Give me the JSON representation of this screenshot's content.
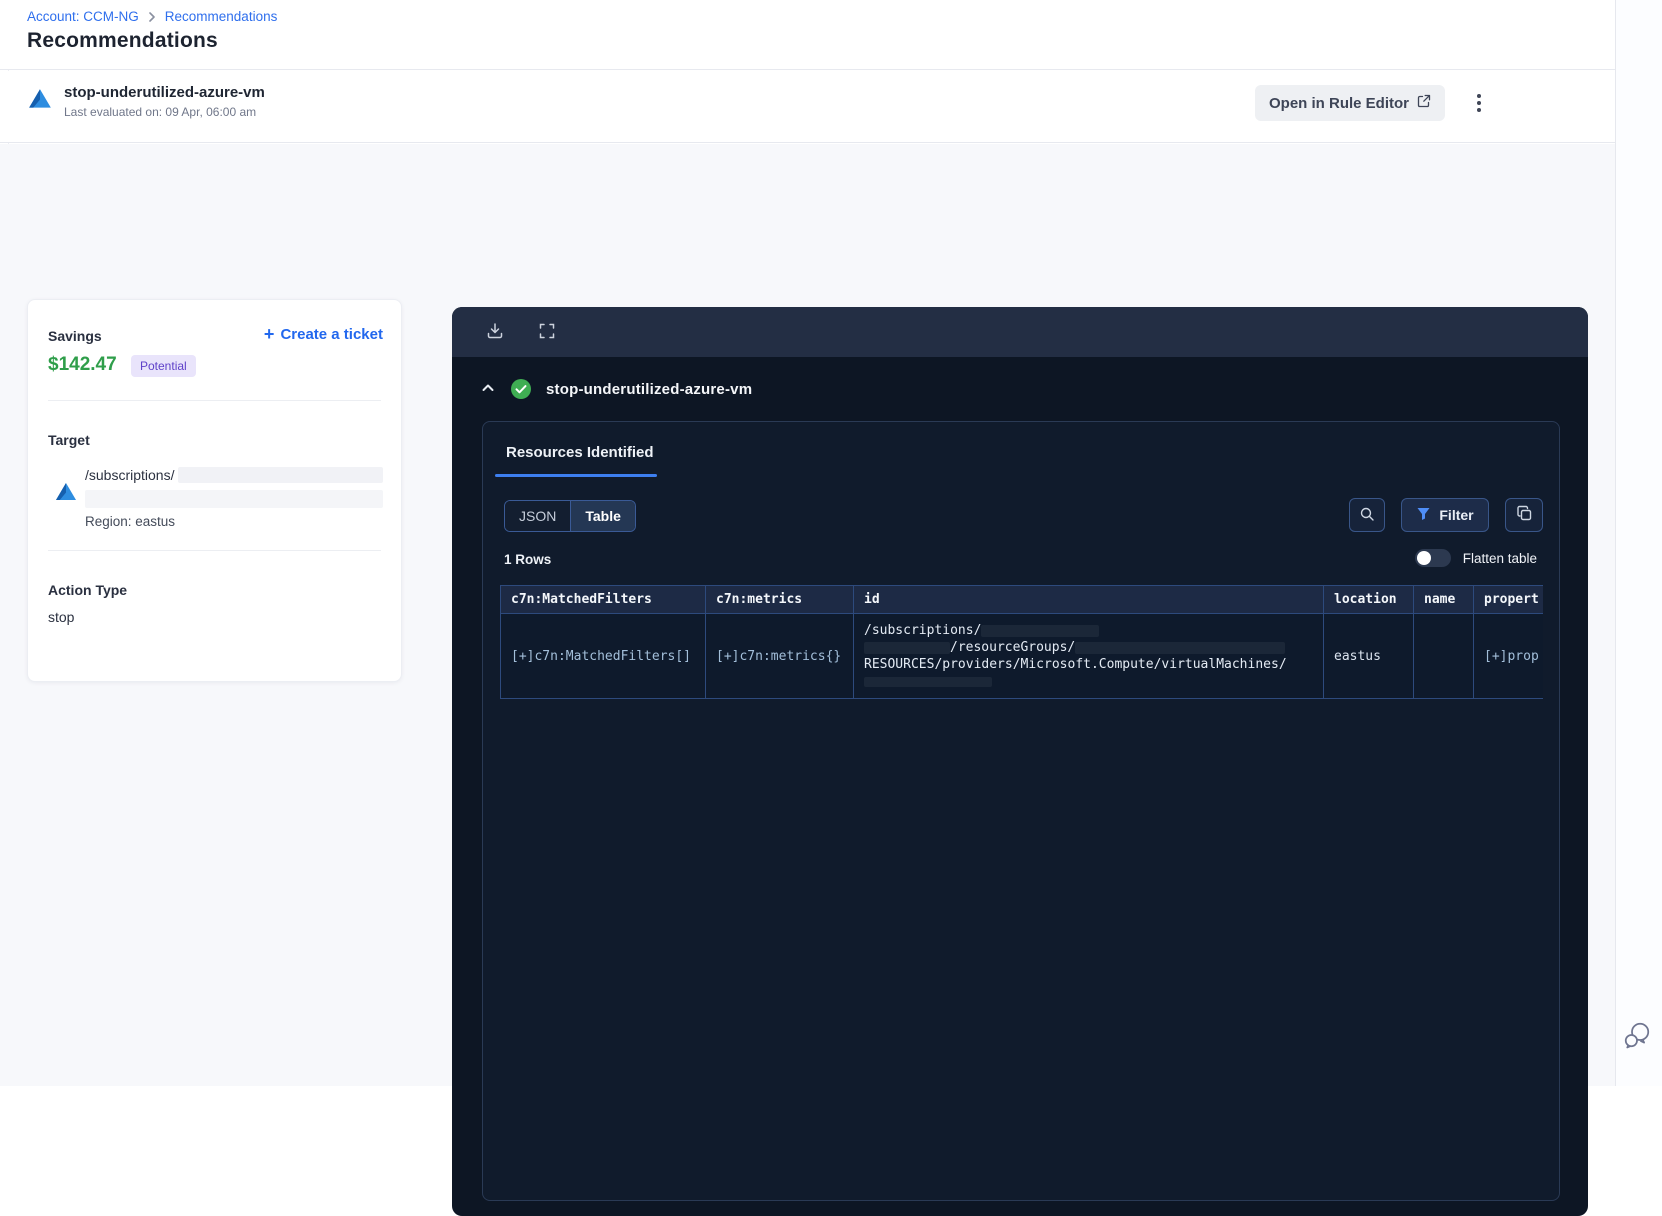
{
  "breadcrumb": {
    "account_link": "Account: CCM-NG",
    "current": "Recommendations"
  },
  "page": {
    "title": "Recommendations"
  },
  "rule_header": {
    "name": "stop-underutilized-azure-vm",
    "last_evaluated": "Last evaluated on: 09 Apr, 06:00 am",
    "open_in_rule_editor": "Open in Rule Editor"
  },
  "savings_card": {
    "savings_label": "Savings",
    "amount": "$142.47",
    "badge": "Potential",
    "create_ticket": {
      "plus": "+",
      "label": "Create a ticket"
    },
    "target": {
      "label": "Target",
      "path": "/subscriptions/",
      "region": "Region: eastus"
    },
    "action_type": {
      "label": "Action Type",
      "value": "stop"
    }
  },
  "viewer": {
    "rule_name": "stop-underutilized-azure-vm",
    "tab_label": "Resources Identified",
    "view_toggle": {
      "json": "JSON",
      "table": "Table",
      "selected": "Table"
    },
    "filter_button": "Filter",
    "rows_count": "1 Rows",
    "flatten_toggle": {
      "label": "Flatten table",
      "state": "off"
    },
    "table": {
      "columns": [
        "c7n:MatchedFilters",
        "c7n:metrics",
        "id",
        "location",
        "name",
        "propert"
      ],
      "rows": [
        {
          "c7n_matched_filters": "[+]c7n:MatchedFilters[]",
          "c7n_metrics": "[+]c7n:metrics{}",
          "id_line_1": "/subscriptions/",
          "id_line_2": "/resourceGroups/",
          "id_line_3": "RESOURCES/providers/Microsoft.Compute/virtualMachines/",
          "location": "eastus",
          "name": "",
          "properties": "[+]prop"
        }
      ]
    }
  },
  "colors": {
    "accent_blue": "#2f6fed",
    "savings_green": "#2f9e4a",
    "badge_purple_text": "#5f41c9",
    "badge_purple_bg": "#e9e4fb",
    "panel_dark": "#0d1624",
    "toolbar_dark": "#232e44",
    "table_border_blue": "#2d4a7d",
    "tab_underline": "#3d7ff0",
    "success_green": "#3fae53"
  }
}
